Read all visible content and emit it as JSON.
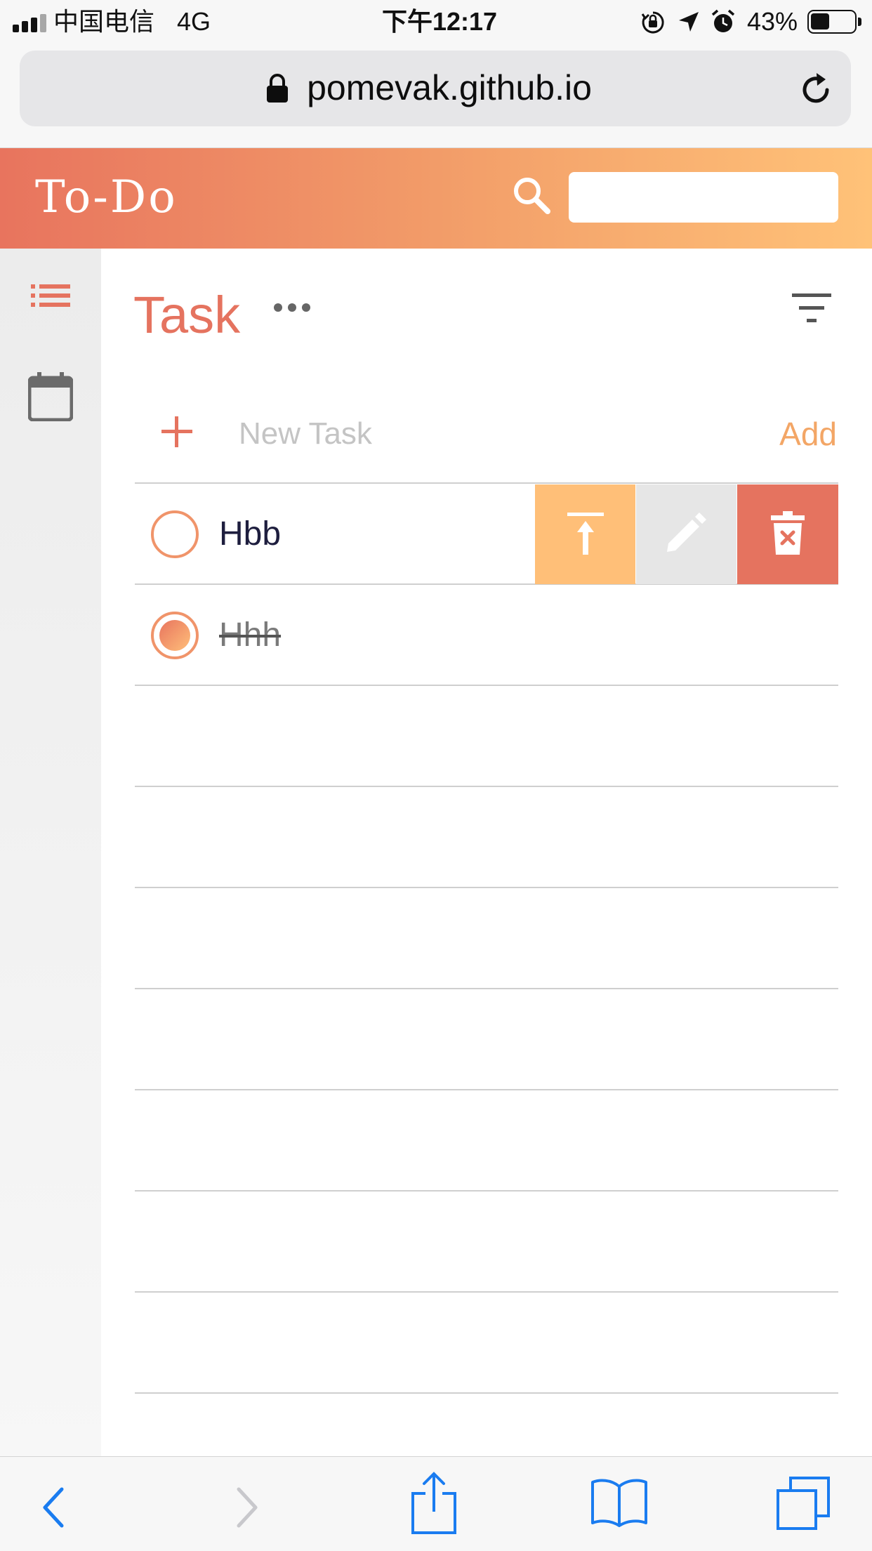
{
  "status_bar": {
    "carrier": "中国电信",
    "network": "4G",
    "time": "下午12:17",
    "battery": "43%"
  },
  "browser": {
    "url": "pomevak.github.io"
  },
  "app": {
    "title": "To-Do",
    "search_placeholder": ""
  },
  "sidebar": {
    "items": [
      {
        "icon": "list-icon",
        "active": true
      },
      {
        "icon": "calendar-icon",
        "active": false
      }
    ]
  },
  "main": {
    "title": "Task",
    "new_task_placeholder": "New Task",
    "add_label": "Add",
    "tasks": [
      {
        "text": "Hbb",
        "done": false
      },
      {
        "text": "Hhh",
        "done": true
      }
    ]
  },
  "colors": {
    "accent": "#e5735f",
    "gradient_start": "#e8745e",
    "gradient_end": "#ffc278",
    "pin_action": "#ffbf78",
    "edit_action": "#e6e6e6",
    "delete_action": "#e5735f",
    "ios_blue": "#1a7cf0"
  }
}
